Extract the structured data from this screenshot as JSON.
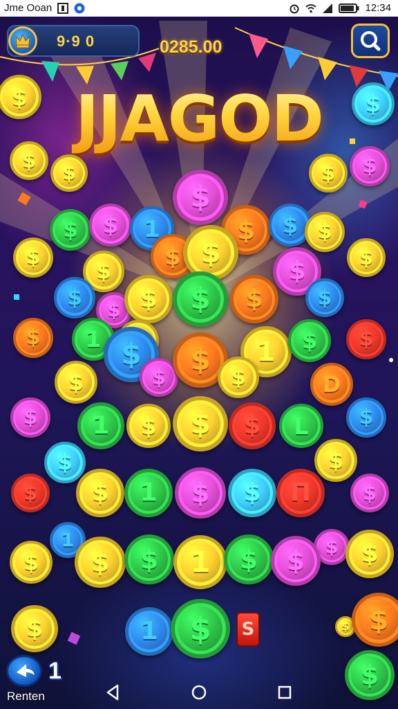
{
  "status_bar": {
    "left_text": "Jme Ooan",
    "time": "12:34"
  },
  "top_bar": {
    "level_value": "9·9 0",
    "score": "0285.00",
    "level_icon": "crown-icon",
    "search_icon": "search-icon"
  },
  "title": "JJAGOD",
  "coins": [
    {
      "glyph": "$",
      "color": "yellow"
    },
    {
      "glyph": "$",
      "color": "yellow"
    },
    {
      "glyph": "$",
      "color": "yellow"
    },
    {
      "glyph": "$",
      "color": "cyan"
    },
    {
      "glyph": "$",
      "color": "magenta"
    },
    {
      "glyph": "$",
      "color": "yellow"
    },
    {
      "glyph": "$",
      "color": "magenta"
    },
    {
      "glyph": "$",
      "color": "green"
    },
    {
      "glyph": "$",
      "color": "magenta"
    },
    {
      "glyph": "1",
      "color": "blue"
    },
    {
      "glyph": "$",
      "color": "orange"
    },
    {
      "glyph": "$",
      "color": "blue"
    },
    {
      "glyph": "$",
      "color": "yellow"
    },
    {
      "glyph": "$",
      "color": "yellow"
    },
    {
      "glyph": "$",
      "color": "yellow"
    },
    {
      "glyph": "$",
      "color": "orange"
    },
    {
      "glyph": "$",
      "color": "yellow"
    },
    {
      "glyph": "$",
      "color": "magenta"
    },
    {
      "glyph": "$",
      "color": "yellow"
    },
    {
      "glyph": "$",
      "color": "blue"
    },
    {
      "glyph": "$",
      "color": "magenta"
    },
    {
      "glyph": "$",
      "color": "yellow"
    },
    {
      "glyph": "$",
      "color": "green"
    },
    {
      "glyph": "$",
      "color": "orange"
    },
    {
      "glyph": "$",
      "color": "blue"
    },
    {
      "glyph": "$",
      "color": "orange"
    },
    {
      "glyph": "1",
      "color": "green"
    },
    {
      "glyph": "$",
      "color": "yellow"
    },
    {
      "glyph": "1",
      "color": "yellow"
    },
    {
      "glyph": "$",
      "color": "green"
    },
    {
      "glyph": "$",
      "color": "red"
    },
    {
      "glyph": "$",
      "color": "yellow"
    },
    {
      "glyph": "$",
      "color": "blue"
    },
    {
      "glyph": "$",
      "color": "magenta"
    },
    {
      "glyph": "$",
      "color": "orange"
    },
    {
      "glyph": "$",
      "color": "yellow"
    },
    {
      "glyph": "D",
      "color": "orange"
    },
    {
      "glyph": "$",
      "color": "magenta"
    },
    {
      "glyph": "1",
      "color": "green"
    },
    {
      "glyph": "$",
      "color": "yellow"
    },
    {
      "glyph": "$",
      "color": "yellow"
    },
    {
      "glyph": "$",
      "color": "red"
    },
    {
      "glyph": "L",
      "color": "green"
    },
    {
      "glyph": "$",
      "color": "blue"
    },
    {
      "glyph": "$",
      "color": "cyan"
    },
    {
      "glyph": "$",
      "color": "yellow"
    },
    {
      "glyph": "$",
      "color": "red"
    },
    {
      "glyph": "$",
      "color": "yellow"
    },
    {
      "glyph": "1",
      "color": "green"
    },
    {
      "glyph": "$",
      "color": "magenta"
    },
    {
      "glyph": "$",
      "color": "cyan"
    },
    {
      "glyph": "П",
      "color": "red"
    },
    {
      "glyph": "$",
      "color": "magenta"
    },
    {
      "glyph": "1",
      "color": "blue"
    },
    {
      "glyph": "$",
      "color": "yellow"
    },
    {
      "glyph": "$",
      "color": "green"
    },
    {
      "glyph": "1",
      "color": "yellow"
    },
    {
      "glyph": "$",
      "color": "green"
    },
    {
      "glyph": "$",
      "color": "magenta"
    },
    {
      "glyph": "$",
      "color": "magenta"
    },
    {
      "glyph": "$",
      "color": "yellow"
    },
    {
      "glyph": "$",
      "color": "yellow"
    },
    {
      "glyph": "$",
      "color": "yellow"
    },
    {
      "glyph": "$",
      "color": "yellow"
    },
    {
      "glyph": "1",
      "color": "blue"
    },
    {
      "glyph": "$",
      "color": "green"
    },
    {
      "glyph": "$",
      "color": "orange"
    },
    {
      "glyph": "$",
      "color": "green"
    }
  ],
  "bottom": {
    "back_icon": "back-arrow-icon",
    "count": "1",
    "label": "Renten",
    "red_tag": "S"
  },
  "nav": {
    "back_icon": "nav-back-icon",
    "home_icon": "nav-home-icon",
    "recents_icon": "nav-recents-icon"
  },
  "colors": {
    "yellow": "#ffd230",
    "orange": "#ff7a1e",
    "red": "#f2382c",
    "magenta": "#e64fd8",
    "green": "#2fc84a",
    "blue": "#2f8cf0",
    "cyan": "#3fd0ff",
    "gold_text": "#ffd24a"
  }
}
